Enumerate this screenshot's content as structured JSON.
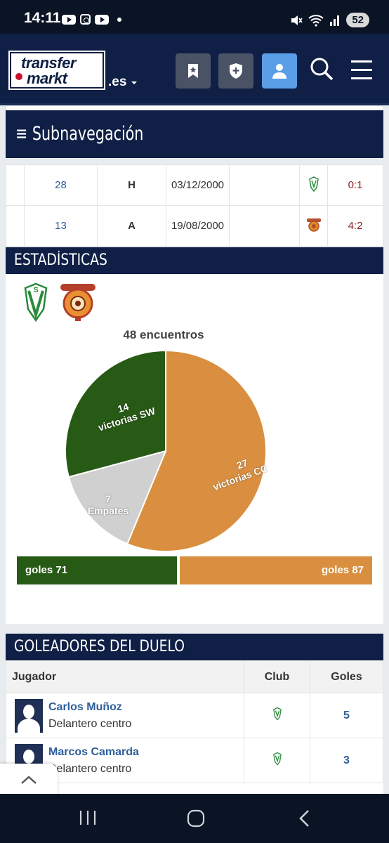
{
  "status_bar": {
    "time": "14:11",
    "battery": "52"
  },
  "header": {
    "logo_line1": "transfer",
    "logo_line2": "markt",
    "lang": ".es"
  },
  "subnav": {
    "title": "≡ Subnavegación"
  },
  "matches": [
    {
      "matchday": "28",
      "venue": "H",
      "date": "03/12/2000",
      "result": "0:1"
    },
    {
      "matchday": "13",
      "venue": "A",
      "date": "19/08/2000",
      "result": "4:2"
    }
  ],
  "stats": {
    "title": "ESTADÍSTICAS",
    "goals_left": "goles 71",
    "goals_right": "goles 87"
  },
  "chart_data": {
    "type": "pie",
    "title": "48 encuentros",
    "slices": [
      {
        "label": "victorias SW",
        "value": 14,
        "color": "#275a14"
      },
      {
        "label": "Empates",
        "value": 7,
        "color": "#d0d0d0"
      },
      {
        "label": "victorias COB",
        "value": 27,
        "color": "#d98f3f"
      }
    ],
    "labels": [
      "14",
      "victorias SW",
      "7",
      "Empates",
      "27",
      "victorias CO"
    ]
  },
  "scorers": {
    "title": "GOLEADORES DEL DUELO",
    "col_player": "Jugador",
    "col_club": "Club",
    "col_goals": "Goles",
    "rows": [
      {
        "name": "Carlos Muñoz",
        "position": "Delantero centro",
        "goals": "5"
      },
      {
        "name": "Marcos Camarda",
        "position": "Delantero centro",
        "goals": "3"
      }
    ]
  },
  "colors": {
    "navy": "#0f1f45",
    "green": "#275a14",
    "orange": "#d98f3f",
    "link": "#2e5e9a"
  }
}
